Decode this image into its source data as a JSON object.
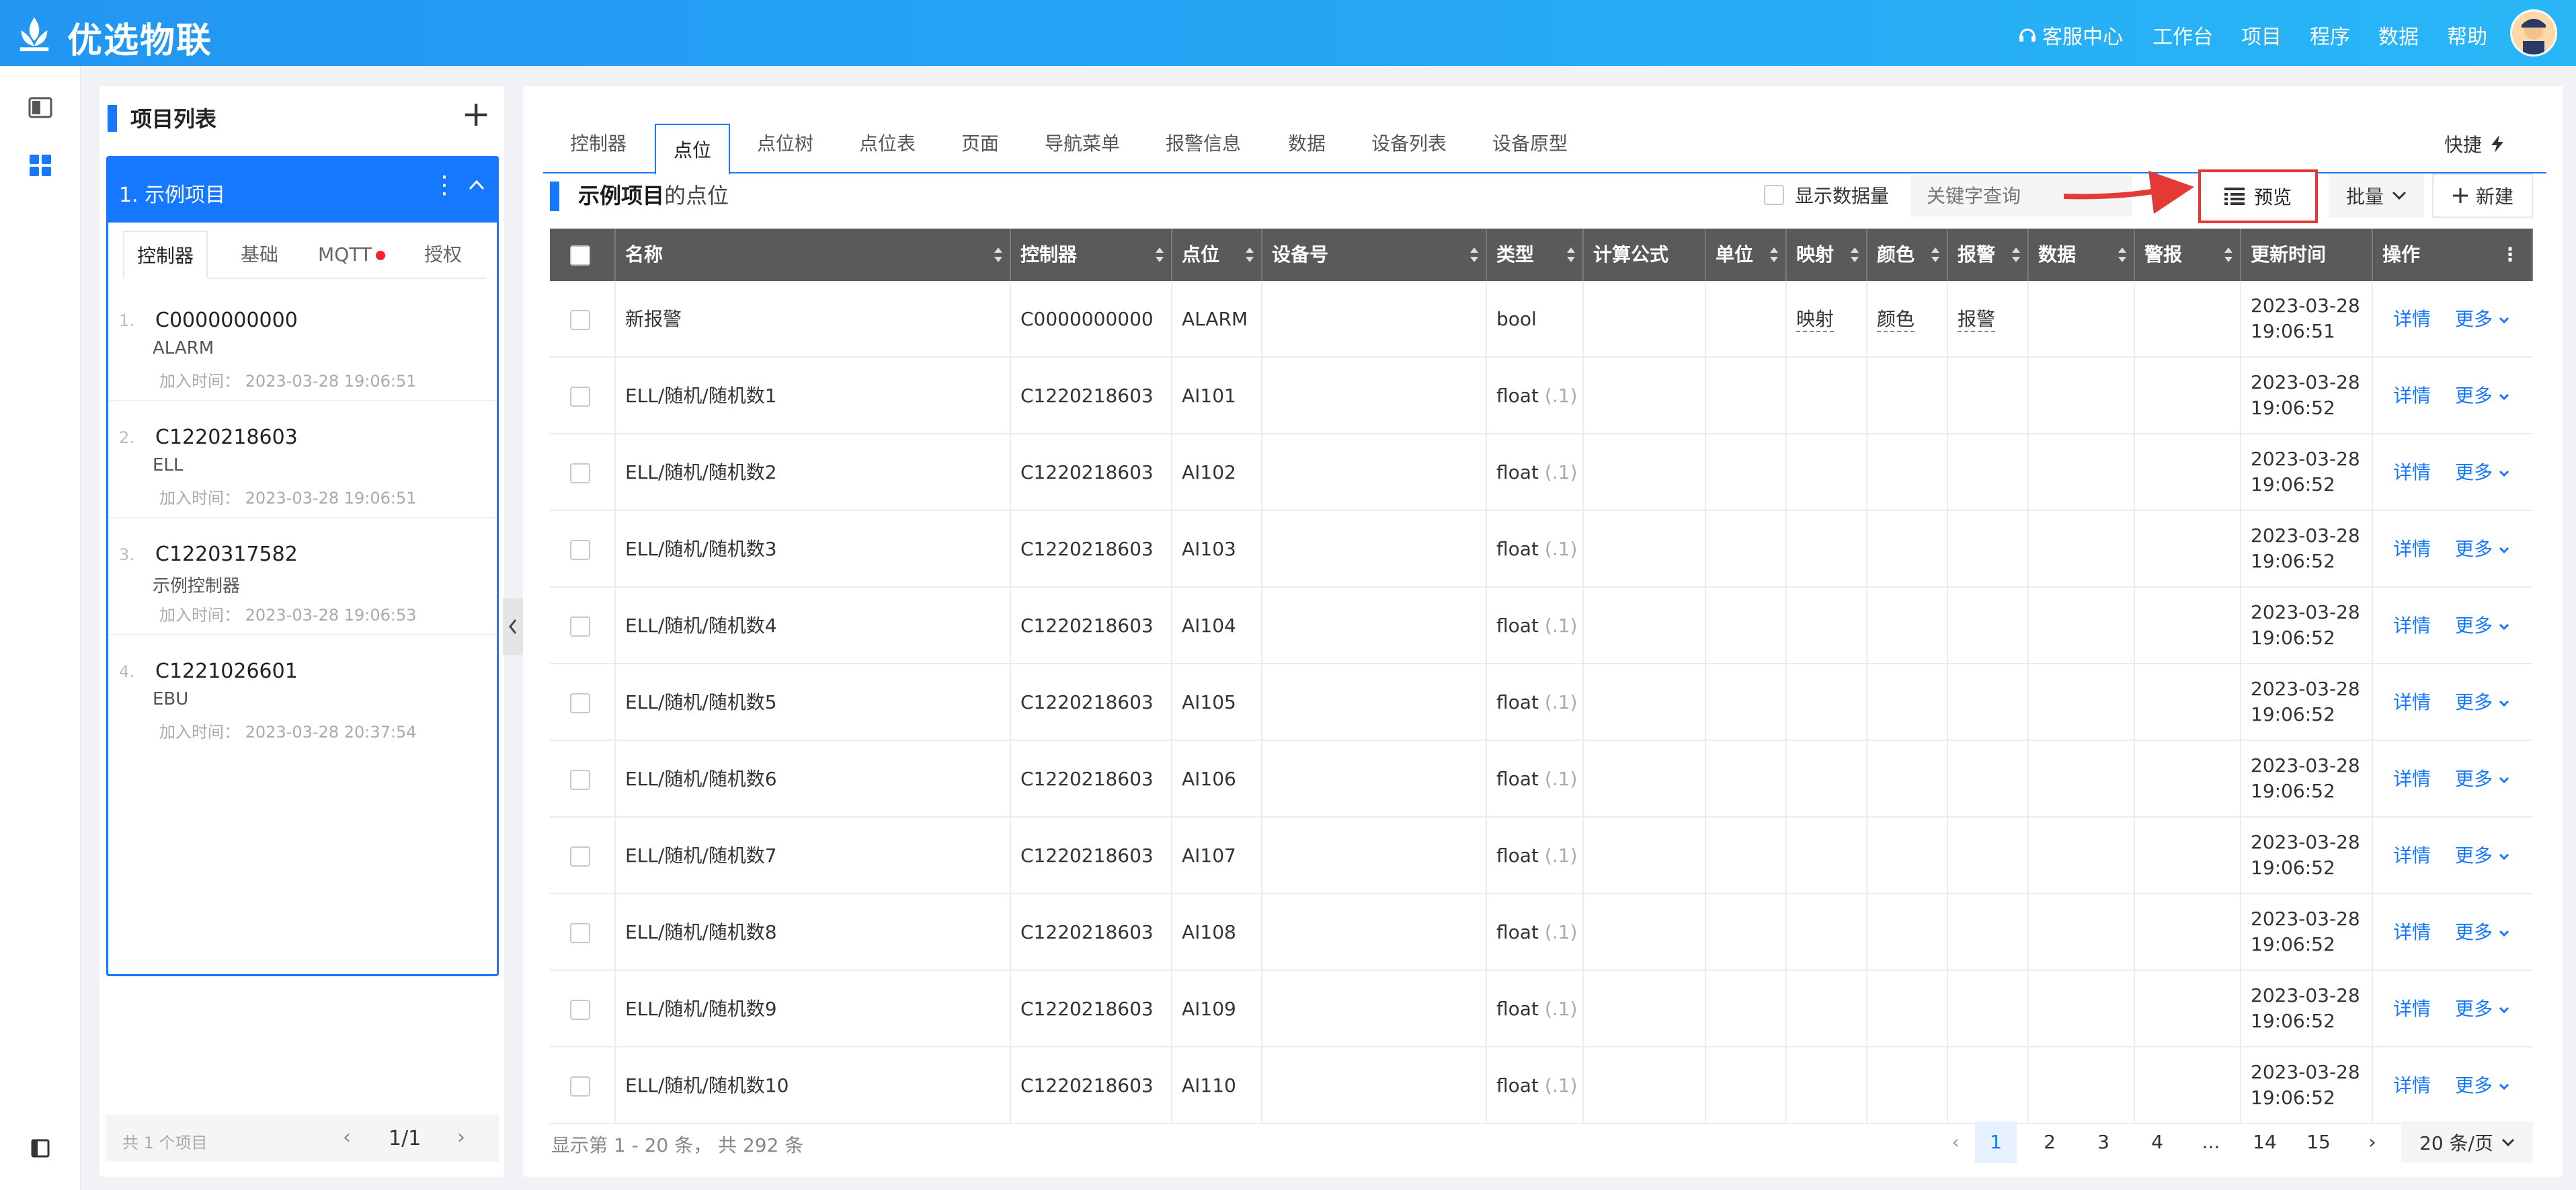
{
  "header": {
    "app_title": "优选物联",
    "nav": [
      "客服中心",
      "工作台",
      "项目",
      "程序",
      "数据",
      "帮助"
    ]
  },
  "project_panel": {
    "title": "项目列表",
    "project": {
      "index": "1.",
      "name": "示例项目"
    },
    "subtabs": [
      "控制器",
      "基础",
      "MQTT",
      "授权"
    ],
    "controllers": [
      {
        "index": "1.",
        "id": "C0000000000",
        "name": "ALARM",
        "time_label": "加入时间：",
        "time": "2023-03-28 19:06:51"
      },
      {
        "index": "2.",
        "id": "C1220218603",
        "name": "ELL",
        "time_label": "加入时间：",
        "time": "2023-03-28 19:06:51"
      },
      {
        "index": "3.",
        "id": "C1220317582",
        "name": "示例控制器",
        "time_label": "加入时间：",
        "time": "2023-03-28 19:06:53"
      },
      {
        "index": "4.",
        "id": "C1221026601",
        "name": "EBU",
        "time_label": "加入时间：",
        "time": "2023-03-28 20:37:54"
      }
    ],
    "count_text": "共 1 个项目",
    "pager_text": "1/1"
  },
  "main": {
    "tabs": [
      "控制器",
      "点位",
      "点位树",
      "点位表",
      "页面",
      "导航菜单",
      "报警信息",
      "数据",
      "设备列表",
      "设备原型"
    ],
    "quick_label": "快捷",
    "section_title": "示例项目",
    "section_suffix": "的点位",
    "show_qty_label": "显示数据量",
    "search_placeholder": "关键字查询",
    "preview_label": "预览",
    "batch_label": "批量",
    "new_label": "新建",
    "columns": [
      "名称",
      "控制器",
      "点位",
      "设备号",
      "类型",
      "计算公式",
      "单位",
      "映射",
      "颜色",
      "报警",
      "数据",
      "警报",
      "更新时间",
      "操作"
    ],
    "rows": [
      {
        "name": "新报警",
        "ctrl": "C0000000000",
        "point": "ALARM",
        "type": "bool",
        "precision": "",
        "map": "映射",
        "color": "颜色",
        "alarm": "报警",
        "date": "2023-03-28",
        "time": "19:06:51"
      },
      {
        "name": "ELL/随机/随机数1",
        "ctrl": "C1220218603",
        "point": "AI101",
        "type": "float",
        "precision": "(.1)",
        "map": "",
        "color": "",
        "alarm": "",
        "date": "2023-03-28",
        "time": "19:06:52"
      },
      {
        "name": "ELL/随机/随机数2",
        "ctrl": "C1220218603",
        "point": "AI102",
        "type": "float",
        "precision": "(.1)",
        "map": "",
        "color": "",
        "alarm": "",
        "date": "2023-03-28",
        "time": "19:06:52"
      },
      {
        "name": "ELL/随机/随机数3",
        "ctrl": "C1220218603",
        "point": "AI103",
        "type": "float",
        "precision": "(.1)",
        "map": "",
        "color": "",
        "alarm": "",
        "date": "2023-03-28",
        "time": "19:06:52"
      },
      {
        "name": "ELL/随机/随机数4",
        "ctrl": "C1220218603",
        "point": "AI104",
        "type": "float",
        "precision": "(.1)",
        "map": "",
        "color": "",
        "alarm": "",
        "date": "2023-03-28",
        "time": "19:06:52"
      },
      {
        "name": "ELL/随机/随机数5",
        "ctrl": "C1220218603",
        "point": "AI105",
        "type": "float",
        "precision": "(.1)",
        "map": "",
        "color": "",
        "alarm": "",
        "date": "2023-03-28",
        "time": "19:06:52"
      },
      {
        "name": "ELL/随机/随机数6",
        "ctrl": "C1220218603",
        "point": "AI106",
        "type": "float",
        "precision": "(.1)",
        "map": "",
        "color": "",
        "alarm": "",
        "date": "2023-03-28",
        "time": "19:06:52"
      },
      {
        "name": "ELL/随机/随机数7",
        "ctrl": "C1220218603",
        "point": "AI107",
        "type": "float",
        "precision": "(.1)",
        "map": "",
        "color": "",
        "alarm": "",
        "date": "2023-03-28",
        "time": "19:06:52"
      },
      {
        "name": "ELL/随机/随机数8",
        "ctrl": "C1220218603",
        "point": "AI108",
        "type": "float",
        "precision": "(.1)",
        "map": "",
        "color": "",
        "alarm": "",
        "date": "2023-03-28",
        "time": "19:06:52"
      },
      {
        "name": "ELL/随机/随机数9",
        "ctrl": "C1220218603",
        "point": "AI109",
        "type": "float",
        "precision": "(.1)",
        "map": "",
        "color": "",
        "alarm": "",
        "date": "2023-03-28",
        "time": "19:06:52"
      },
      {
        "name": "ELL/随机/随机数10",
        "ctrl": "C1220218603",
        "point": "AI110",
        "type": "float",
        "precision": "(.1)",
        "map": "",
        "color": "",
        "alarm": "",
        "date": "2023-03-28",
        "time": "19:06:52"
      }
    ],
    "action_detail": "详情",
    "action_more": "更多",
    "footer_info": "显示第 1 - 20 条， 共 292 条",
    "pages": [
      "1",
      "2",
      "3",
      "4",
      "...",
      "14",
      "15"
    ],
    "page_size": "20 条/页"
  },
  "colors": {
    "primary": "#1677ff",
    "header": "#2196f3",
    "highlight": "#e53935"
  }
}
